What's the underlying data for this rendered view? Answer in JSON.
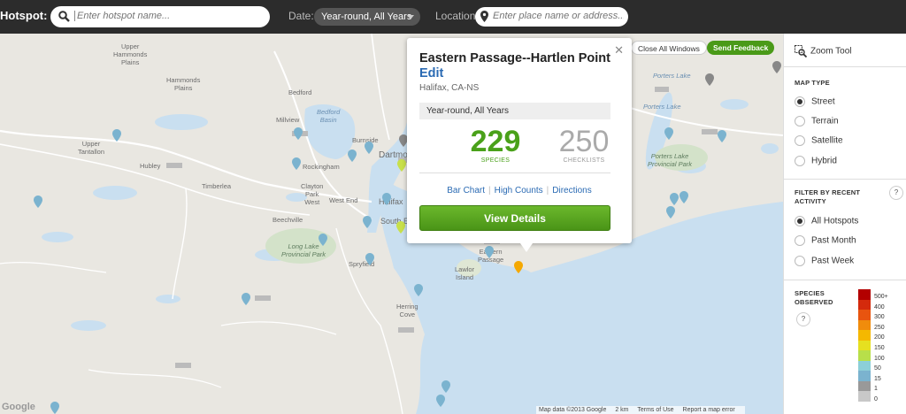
{
  "topbar": {
    "hotspot_label": "Hotspot:",
    "search_placeholder": "Enter hotspot name...",
    "date_label": "Date:",
    "date_value": "Year-round, All Years",
    "location_label": "Location:",
    "location_placeholder": "Enter place name or address..."
  },
  "map": {
    "close_all_label": "Close All Windows",
    "feedback_label": "Send Feedback",
    "google_logo": "Google",
    "footer": {
      "map_data": "Map data ©2013 Google",
      "scale": "2 km",
      "terms": "Terms of Use",
      "report": "Report a map error"
    },
    "labels": {
      "upper_hammonds": "Upper\nHammonds\nPlains",
      "hammonds": "Hammonds\nPlains",
      "bedford": "Bedford",
      "millview": "Millview",
      "bedford_basin": "Bedford\nBasin",
      "burnside": "Burnside",
      "upper_tantallon": "Upper\nTantallon",
      "hubley": "Hubley",
      "rockingham": "Rockingham",
      "timberlea": "Timberlea",
      "clayton_park": "Clayton\nPark\nWest",
      "dartmouth": "Dartmo",
      "west_end": "West End",
      "halifax": "Halifax",
      "beechville": "Beechville",
      "south_end": "South E",
      "long_lake": "Long Lake\nProvincial Park",
      "spryfield": "Spryfield",
      "lawlor": "Lawlor\nIsland",
      "eastern_passage": "Eastern\nPassage",
      "herring_cove": "Herring\nCove",
      "porters_lake_top": "Porters Lake",
      "porters_lake": "Porters Lake",
      "porters_lake_park": "Porters Lake\nProvincial Park"
    }
  },
  "popup": {
    "title": "Eastern Passage--Hartlen Point",
    "edit_label": "Edit",
    "region": "Halifax, CA-NS",
    "period": "Year-round, All Years",
    "species_count": "229",
    "species_label": "SPECIES",
    "checklist_count": "250",
    "checklist_label": "CHECKLISTS",
    "links": [
      "Bar Chart",
      "High Counts",
      "Directions"
    ],
    "view_details": "View Details"
  },
  "panel": {
    "zoom_tool": "Zoom Tool",
    "map_type_head": "MAP TYPE",
    "map_types": [
      "Street",
      "Terrain",
      "Satellite",
      "Hybrid"
    ],
    "map_type_selected": "Street",
    "filter_head": "FILTER BY RECENT ACTIVITY",
    "filters": [
      "All Hotspots",
      "Past Month",
      "Past Week"
    ],
    "filter_selected": "All Hotspots",
    "species_head": "SPECIES OBSERVED",
    "help_glyph": "?",
    "legend": [
      {
        "label": "500+",
        "color": "#b30000"
      },
      {
        "label": "400",
        "color": "#d42a0c"
      },
      {
        "label": "300",
        "color": "#e8540f"
      },
      {
        "label": "250",
        "color": "#f08c0c"
      },
      {
        "label": "200",
        "color": "#f5b800"
      },
      {
        "label": "150",
        "color": "#e6e020"
      },
      {
        "label": "100",
        "color": "#b8df4a"
      },
      {
        "label": "50",
        "color": "#8ccfd8"
      },
      {
        "label": "15",
        "color": "#7bb3cf"
      },
      {
        "label": "1",
        "color": "#999999"
      },
      {
        "label": "0",
        "color": "#c8c8c8"
      }
    ]
  },
  "colors": {
    "accent_green": "#4aa11a",
    "link_blue": "#2a6ab3",
    "topbar_bg": "#2c2c2c"
  }
}
